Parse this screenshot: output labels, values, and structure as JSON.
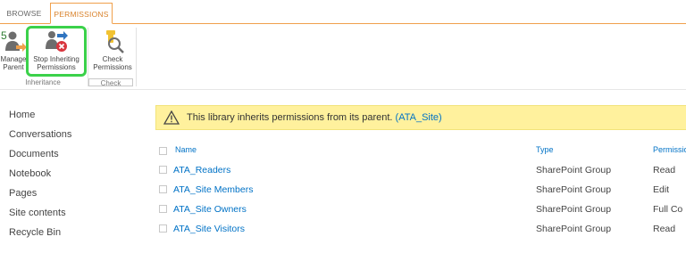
{
  "tabs": [
    {
      "label": "BROWSE"
    },
    {
      "label": "PERMISSIONS"
    }
  ],
  "ribbon": {
    "manage_parent": "Manage\nParent",
    "stop_inheriting": "Stop Inheriting\nPermissions",
    "check_permissions": "Check\nPermissions",
    "group_inheritance": "Inheritance",
    "group_check": "Check"
  },
  "left_nav": [
    {
      "label": "Home"
    },
    {
      "label": "Conversations"
    },
    {
      "label": "Documents"
    },
    {
      "label": "Notebook"
    },
    {
      "label": "Pages"
    },
    {
      "label": "Site contents"
    },
    {
      "label": "Recycle Bin"
    }
  ],
  "notice": {
    "message": "This library inherits permissions from its parent.",
    "link": "(ATA_Site)"
  },
  "table": {
    "headers": {
      "name": "Name",
      "type": "Type",
      "permissions": "Permissio"
    },
    "rows": [
      {
        "name": "ATA_Readers",
        "type": "SharePoint Group",
        "permissions": "Read"
      },
      {
        "name": "ATA_Site Members",
        "type": "SharePoint Group",
        "permissions": "Edit"
      },
      {
        "name": "ATA_Site Owners",
        "type": "SharePoint Group",
        "permissions": "Full Co"
      },
      {
        "name": "ATA_Site Visitors",
        "type": "SharePoint Group",
        "permissions": "Read"
      }
    ]
  },
  "colors": {
    "accent": "#f0a04b",
    "link": "#0072c6",
    "notice_bg": "#fff19d",
    "highlight": "#3bd14a"
  }
}
